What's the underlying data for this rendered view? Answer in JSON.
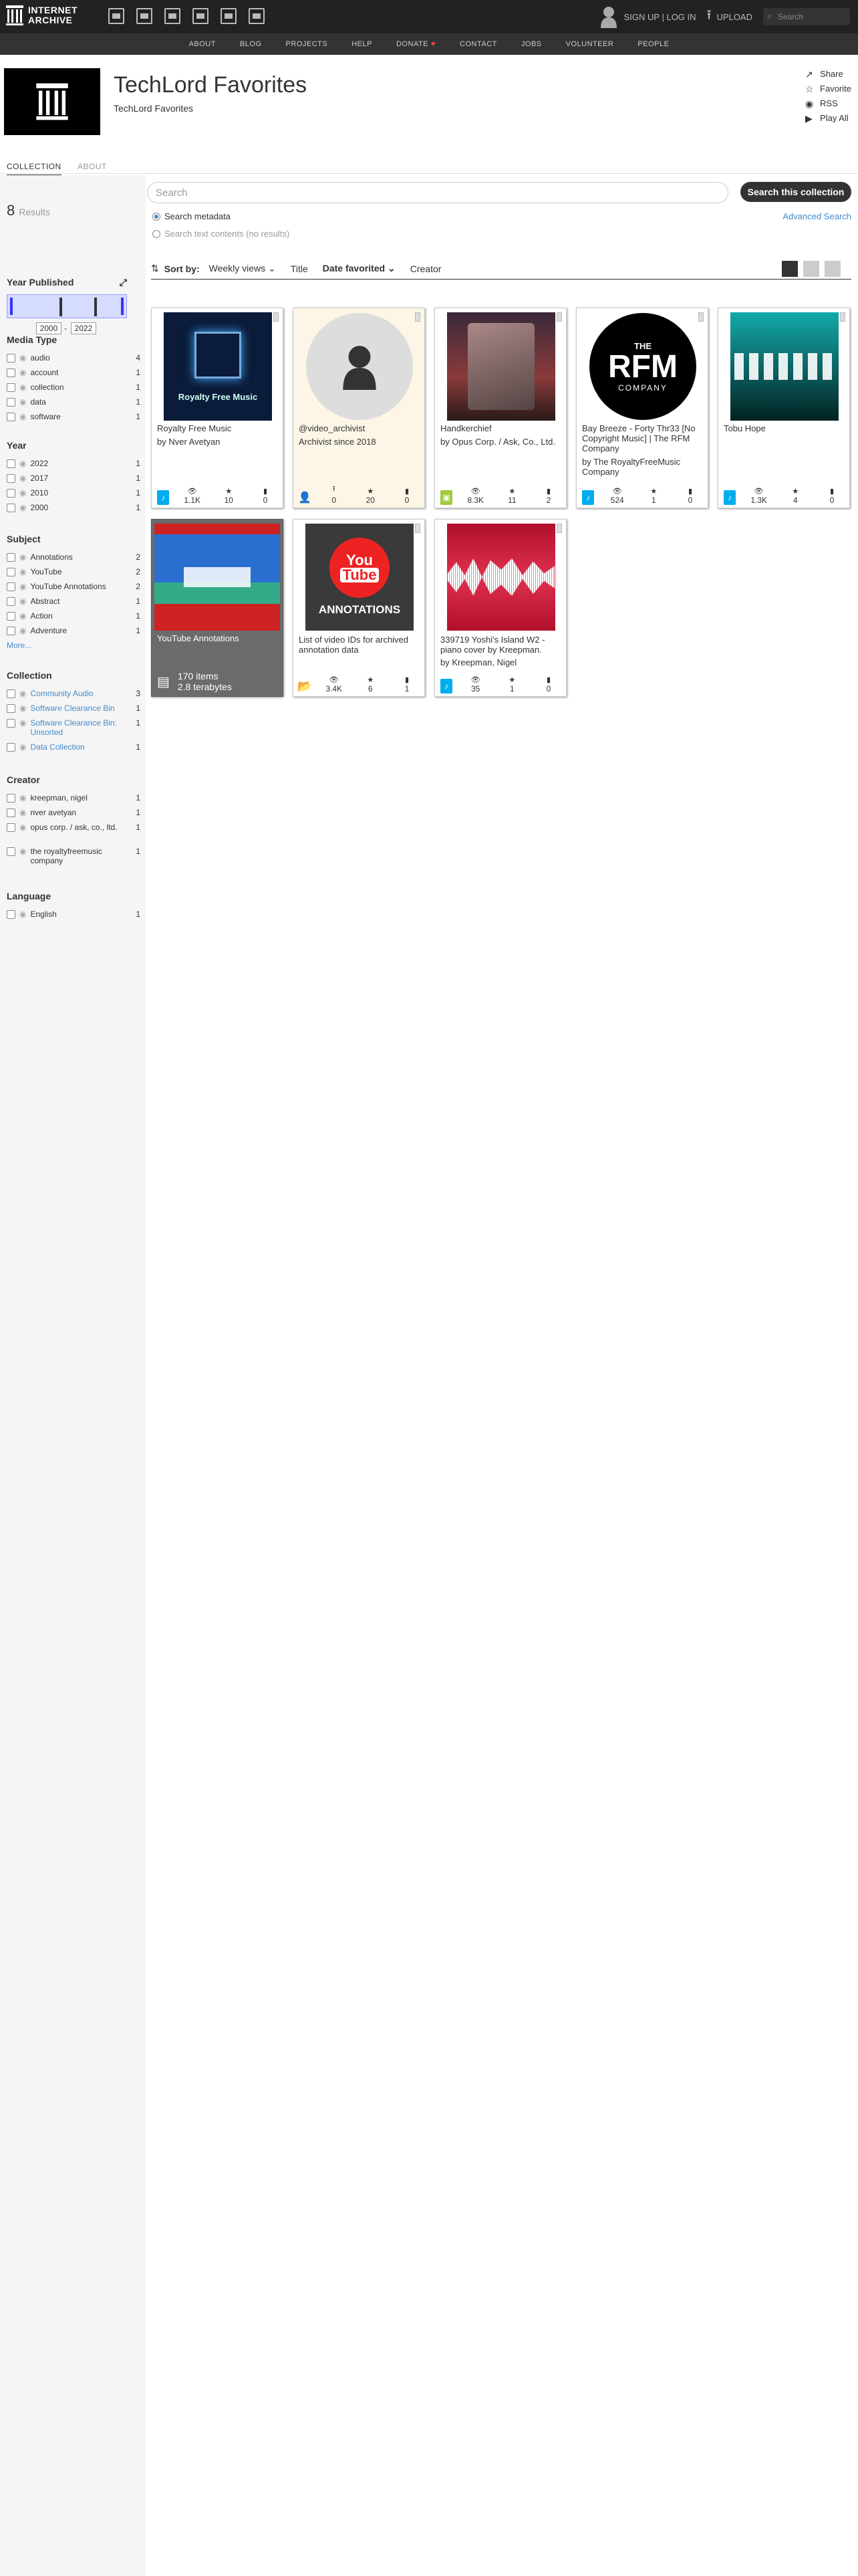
{
  "topnav": {
    "logo_line1": "INTERNET",
    "logo_line2": "ARCHIVE",
    "user_link": "SIGN UP | LOG IN",
    "upload_label": "UPLOAD",
    "search_placeholder": "Search"
  },
  "subnav": [
    "ABOUT",
    "BLOG",
    "PROJECTS",
    "HELP",
    "DONATE",
    "CONTACT",
    "JOBS",
    "VOLUNTEER",
    "PEOPLE"
  ],
  "header": {
    "title": "TechLord Favorites",
    "subtitle": "TechLord Favorites",
    "actions": [
      "Share",
      "Favorite",
      "RSS",
      "Play All"
    ]
  },
  "tabs": [
    "COLLECTION",
    "ABOUT"
  ],
  "results": {
    "count": "8",
    "label": "Results"
  },
  "sidebar": {
    "year_title": "Year Published",
    "year_from": "2000",
    "year_to": "2022",
    "media_type": {
      "title": "Media Type",
      "items": [
        [
          "audio",
          "4"
        ],
        [
          "account",
          "1"
        ],
        [
          "collection",
          "1"
        ],
        [
          "data",
          "1"
        ],
        [
          "software",
          "1"
        ]
      ]
    },
    "year": {
      "title": "Year",
      "items": [
        [
          "2022",
          "1"
        ],
        [
          "2017",
          "1"
        ],
        [
          "2010",
          "1"
        ],
        [
          "2000",
          "1"
        ]
      ]
    },
    "subject": {
      "title": "Subject",
      "items": [
        [
          "Annotations",
          "2"
        ],
        [
          "YouTube",
          "2"
        ],
        [
          "YouTube Annotations",
          "2"
        ],
        [
          "Abstract",
          "1"
        ],
        [
          "Action",
          "1"
        ],
        [
          "Adventure",
          "1"
        ]
      ],
      "more": "More..."
    },
    "collection": {
      "title": "Collection",
      "items": [
        [
          "Community Audio",
          "3"
        ],
        [
          "Software Clearance Bin",
          "1"
        ],
        [
          "Software Clearance Bin: Unsorted",
          "1"
        ],
        [
          "Data Collection",
          "1"
        ]
      ]
    },
    "creator": {
      "title": "Creator",
      "items": [
        [
          "kreepman, nigel",
          "1"
        ],
        [
          "nver avetyan",
          "1"
        ],
        [
          "opus corp. / ask, co., ltd.",
          "1"
        ],
        [
          "the royaltyfreemusic company",
          "1"
        ]
      ]
    },
    "language": {
      "title": "Language",
      "items": [
        [
          "English",
          "1"
        ]
      ]
    }
  },
  "search": {
    "placeholder": "Search",
    "button": "Search this collection",
    "advanced": "Advanced Search",
    "radio_metadata": "Search metadata",
    "radio_text": "Search text contents (no results)"
  },
  "sort": {
    "label": "Sort by:",
    "options": [
      "Weekly views",
      "Title",
      "Date favorited",
      "Creator"
    ]
  },
  "tiles": [
    {
      "title": "Royalty Free Music",
      "by": "by Nver Avetyan",
      "views": "1.1K",
      "favs": "10",
      "reviews": "0",
      "thumb_text": "Royalty Free Music"
    },
    {
      "title": "@video_archivist",
      "by": "Archivist since 2018",
      "uploads": "0",
      "favs": "20",
      "reviews": "0"
    },
    {
      "title": "Handkerchief",
      "by": "by Opus Corp. / Ask, Co., Ltd.",
      "views": "8.3K",
      "favs": "11",
      "reviews": "2"
    },
    {
      "title": "Bay Breeze - Forty Thr33 [No Copyright Music] | The RFM Company",
      "by": "by The RoyaltyFreeMusic Company",
      "views": "524",
      "favs": "1",
      "reviews": "0",
      "thumb_text1": "THE",
      "thumb_text2": "RFM",
      "thumb_text3": "COMPANY"
    },
    {
      "title": "Tobu Hope",
      "views": "1.3K",
      "favs": "4",
      "reviews": "0"
    },
    {
      "title": "YouTube Annotations",
      "items": "170 items",
      "size": "2.8 terabytes"
    },
    {
      "title": "List of video IDs for archived annotation data",
      "views": "3.4K",
      "favs": "6",
      "reviews": "1",
      "thumb_text1": "You",
      "thumb_text2": "Tube",
      "thumb_text3": "ANNOTATIONS"
    },
    {
      "title": "339719 Yoshi's Island W2 - piano cover by Kreepman.",
      "by": "by Kreepman, Nigel",
      "views": "35",
      "favs": "1",
      "reviews": "0"
    }
  ]
}
